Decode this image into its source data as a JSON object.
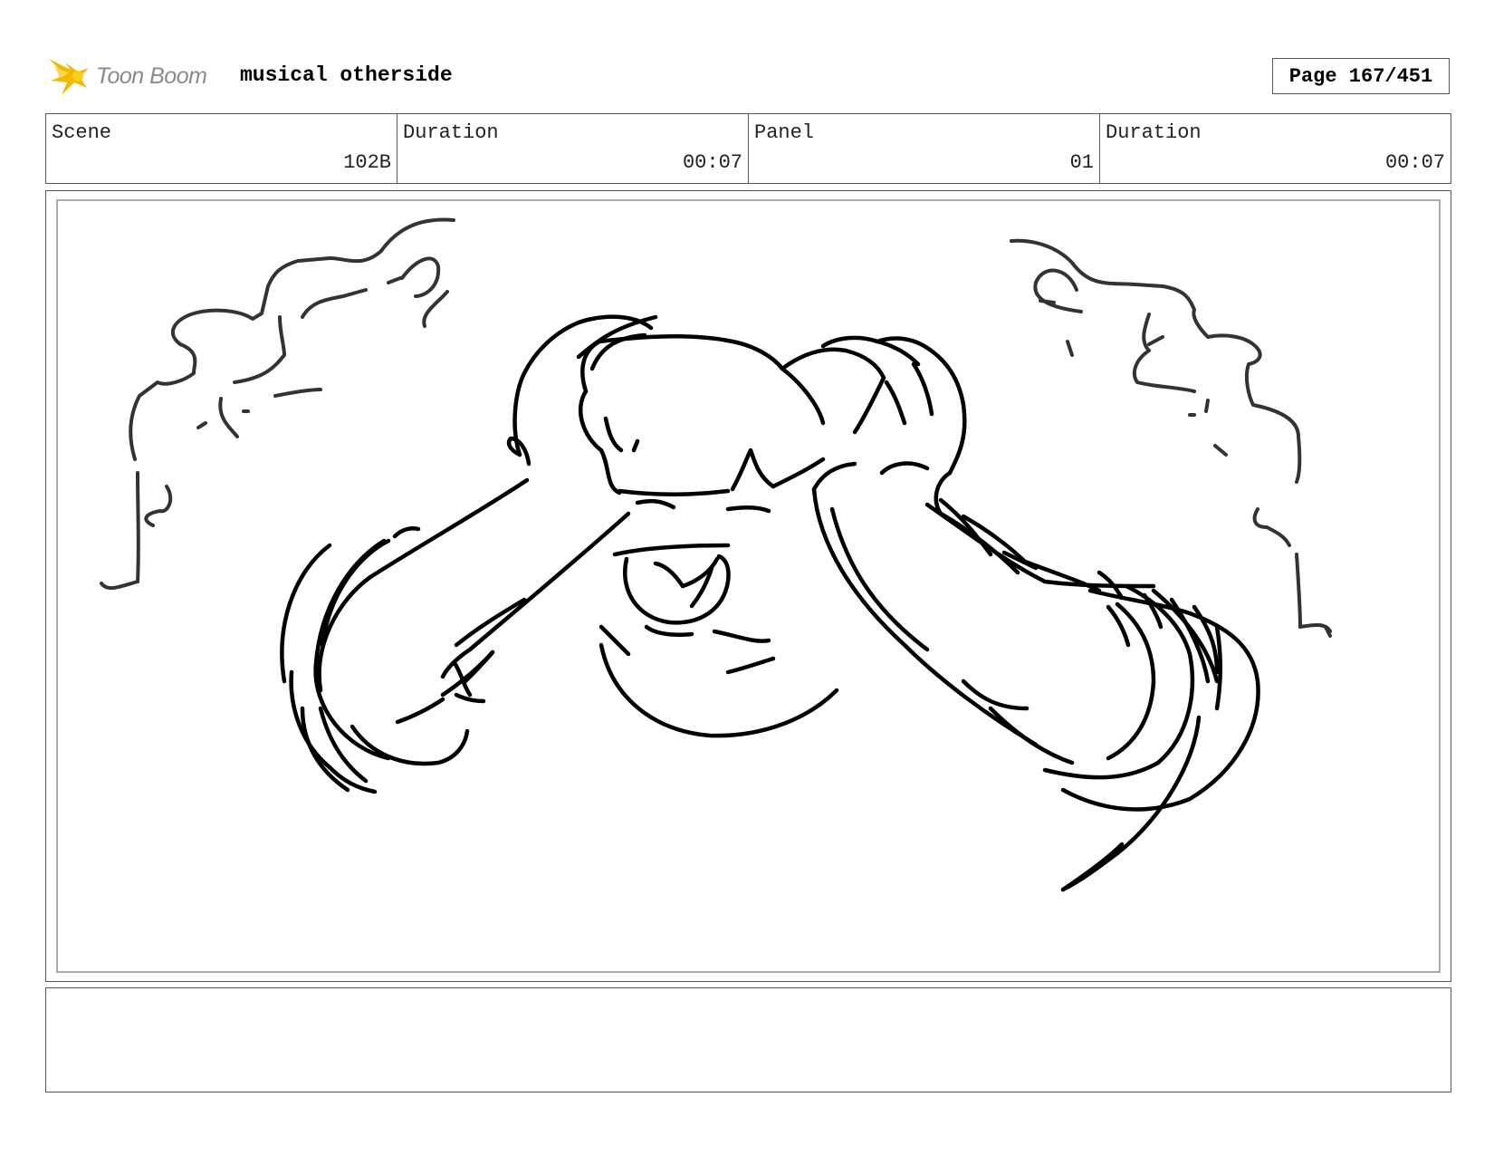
{
  "header": {
    "logo_text": "Toon Boom",
    "project_title": "musical otherside",
    "page_label": "Page 167/451"
  },
  "info": {
    "scene_label": "Scene",
    "scene_value": "102B",
    "scene_duration_label": "Duration",
    "scene_duration_value": "00:07",
    "panel_label": "Panel",
    "panel_value": "01",
    "panel_duration_label": "Duration",
    "panel_duration_value": "00:07"
  },
  "panel": {
    "image_name": "storyboard-sketch-character-clutching-head",
    "dialogue": ""
  },
  "colors": {
    "logo_star": "#f5b800",
    "logo_text": "#8a8a8a",
    "border": "#555555",
    "inner_border": "#aaaaaa",
    "ink": "#000000",
    "smoke": "#333333"
  },
  "icons": {
    "logo": "toon-boom-star-logo"
  }
}
